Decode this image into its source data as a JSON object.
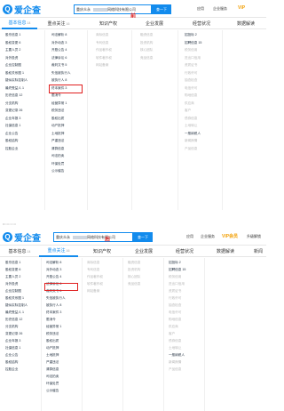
{
  "top": {
    "logo_text": "爱企查",
    "logo_letter": "Q",
    "search_prefix": "重庆众永",
    "search_suffix": "网络科技有限公司",
    "search_button": "查一下",
    "mark": "前",
    "hdr_links": [
      "应用",
      "企业服务"
    ],
    "vip": "VIP"
  },
  "bottom": {
    "logo_text": "爱企查",
    "logo_letter": "Q",
    "search_prefix": "重庆众永",
    "search_suffix": "网络科技有限公司",
    "search_button": "查一下",
    "mark": "后",
    "hdr_links": [
      "应用",
      "企业服务"
    ],
    "vip": "VIP会员",
    "hdr_right": "升级解锁"
  },
  "gap_text": "3 □ □ □ □ □",
  "tabs_top": [
    {
      "label": "基本信息",
      "count": "14"
    },
    {
      "label": "重点关注",
      "count": "16"
    },
    {
      "label": "知识产权",
      "count": ""
    },
    {
      "label": "企业发展",
      "count": ""
    },
    {
      "label": "经营状况",
      "count": ""
    },
    {
      "label": "数据解读",
      "count": ""
    }
  ],
  "tabs_bottom": [
    {
      "label": "基本信息",
      "count": "14"
    },
    {
      "label": "重点关注",
      "count": "16"
    },
    {
      "label": "知识产权",
      "count": ""
    },
    {
      "label": "企业发展",
      "count": ""
    },
    {
      "label": "经营状况",
      "count": ""
    },
    {
      "label": "数据解读",
      "count": ""
    },
    {
      "label": "新闻",
      "count": ""
    }
  ],
  "columns": {
    "c1": [
      "股东信息 1",
      "股权变更 6",
      "主要人员 2",
      "对外投资",
      "企业控制图",
      "股权关系图 1",
      "疑似实际控制人",
      "最终受益人 1",
      "历史信息 12",
      "分支机构",
      "变更记录 26",
      "企业年报 3",
      "社保信息 1",
      "企业公告",
      "股权结构",
      "控股企业"
    ],
    "c2": [
      "司法解析 8",
      "对外动态 3",
      "开庭公告 4",
      "法律诉讼 6",
      "裁判文书 5",
      "失信被执行人",
      "被执行人 8",
      "终本案件 3",
      "限消令",
      "经营异常 1",
      "税务违法",
      "股权出质",
      "动产抵押",
      "土地抵押",
      "严重违法",
      "清算信息",
      "司法拍卖",
      "环保处罚",
      "公示催告"
    ],
    "c3": [
      "商标信息",
      "专利信息",
      "作品著作权",
      "软件著作权",
      "网站备案"
    ],
    "c4": [
      "融资信息",
      "投资机构",
      "核心团队",
      "竞品信息"
    ],
    "c5": [
      "招投标 2",
      "招聘信息 15",
      "税务信用",
      "进出口信用",
      "资质证书",
      "行政许可",
      "抽查检查",
      "电信许可",
      "购地信息",
      "供应商",
      "客户",
      "债券信息",
      "土地转让",
      "一般纳税人",
      "新闻舆情",
      "产品信息"
    ]
  }
}
